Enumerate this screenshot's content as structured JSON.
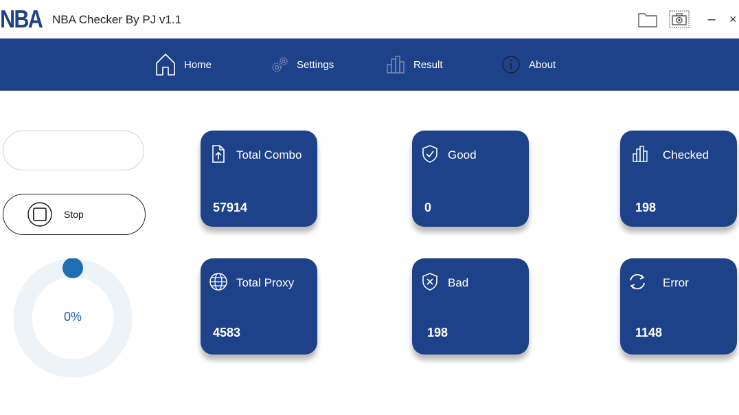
{
  "app": {
    "logo_text": "NBA",
    "title": "NBA Checker By PJ v1.1"
  },
  "window_controls": {
    "minimize_glyph": "–",
    "close_glyph": "×",
    "folder_icon": "folder-icon",
    "camera_icon": "camera-icon"
  },
  "nav": {
    "items": [
      {
        "label": "Home",
        "icon": "home-icon"
      },
      {
        "label": "Settings",
        "icon": "gears-icon"
      },
      {
        "label": "Result",
        "icon": "bar-chart-icon"
      },
      {
        "label": "About",
        "icon": "info-icon"
      }
    ]
  },
  "left_panel": {
    "input_value": "",
    "stop_label": "Stop",
    "progress_text": "0%",
    "progress_value": 0
  },
  "cards": [
    {
      "label": "Total Combo",
      "value": "57914",
      "icon": "file-upload-icon"
    },
    {
      "label": "Good",
      "value": "0",
      "icon": "shield-check-icon"
    },
    {
      "label": "Checked",
      "value": "198",
      "icon": "bar-chart-icon"
    },
    {
      "label": "Total Proxy",
      "value": "4583",
      "icon": "globe-icon"
    },
    {
      "label": "Bad",
      "value": "198",
      "icon": "shield-x-icon"
    },
    {
      "label": "Error",
      "value": "1148",
      "icon": "refresh-icon"
    }
  ],
  "colors": {
    "primary": "#1e428a",
    "accent": "#1f6fb5",
    "track": "#eef3f7"
  }
}
